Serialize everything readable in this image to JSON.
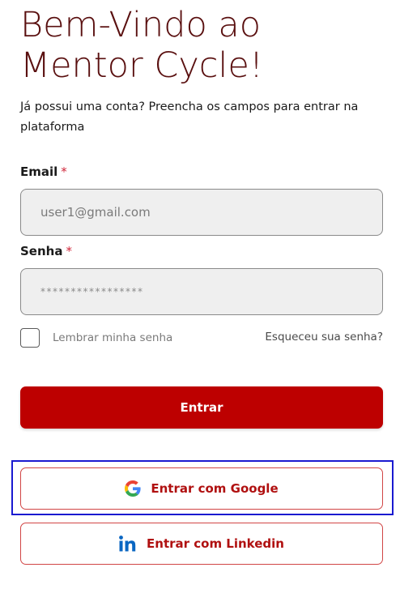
{
  "header": {
    "title_line1": "Bem-Vindo ao",
    "title_line2": "Mentor Cycle!",
    "subtitle": "Já possui uma conta? Preencha os campos para entrar na plataforma"
  },
  "form": {
    "email_label": "Email",
    "email_required": "*",
    "email_value": "user1@gmail.com",
    "password_label": "Senha",
    "password_required": "*",
    "password_value": "*****************",
    "remember_label": "Lembrar minha senha",
    "forgot_link": "Esqueceu sua senha?",
    "submit_label": "Entrar"
  },
  "social": {
    "google_label": "Entrar com Google",
    "linkedin_label": "Entrar com Linkedin"
  },
  "colors": {
    "title": "#5a1010",
    "primary": "#bd0000",
    "social_border": "#d14545",
    "social_text": "#b01010",
    "linkedin_icon": "#0a66c2"
  },
  "icons": {
    "google": "google-icon",
    "linkedin": "linkedin-icon"
  }
}
